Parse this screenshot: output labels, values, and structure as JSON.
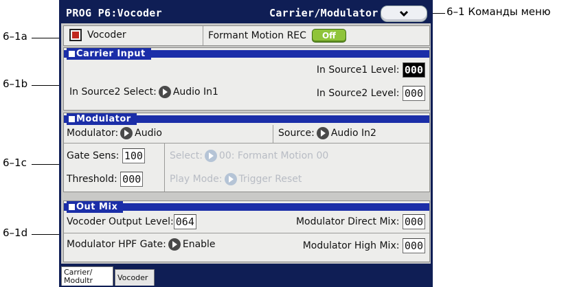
{
  "title": {
    "left": "PROG P6:Vocoder",
    "right": "Carrier/Modulator",
    "menu_icon": "chevron-down-icon"
  },
  "vocoder_row": {
    "checkbox_label": "Vocoder",
    "checkbox_checked": true,
    "formant_label": "Formant Motion REC",
    "formant_button": "Off"
  },
  "carrier_input": {
    "header": "Carrier Input",
    "in_source1_level_label": "In Source1 Level:",
    "in_source1_level_value": "000",
    "in_source2_select_label": "In Source2 Select:",
    "in_source2_select_value": "Audio In1",
    "in_source2_level_label": "In Source2 Level:",
    "in_source2_level_value": "000"
  },
  "modulator": {
    "header": "Modulator",
    "modulator_label": "Modulator:",
    "modulator_value": "Audio",
    "source_label": "Source:",
    "source_value": "Audio In2",
    "gate_sens_label": "Gate Sens:",
    "gate_sens_value": "100",
    "threshold_label": "Threshold:",
    "threshold_value": "000",
    "select_label": "Select:",
    "select_value": "00: Formant Motion 00",
    "play_mode_label": "Play Mode:",
    "play_mode_value": "Trigger Reset"
  },
  "out_mix": {
    "header": "Out Mix",
    "vocoder_output_label": "Vocoder Output Level:",
    "vocoder_output_value": "064",
    "mod_direct_label": "Modulator Direct Mix:",
    "mod_direct_value": "000",
    "hpf_gate_label": "Modulator HPF Gate:",
    "hpf_gate_value": "Enable",
    "high_mix_label": "Modulator High Mix:",
    "high_mix_value": "000"
  },
  "tabs": [
    {
      "label_line1": "Carrier/",
      "label_line2": "Modultr",
      "active": true
    },
    {
      "label_line1": "Vocoder",
      "label_line2": "",
      "active": false
    }
  ],
  "callouts": {
    "menu": "6–1 Команды меню",
    "a": "6–1a",
    "b": "6–1b",
    "c": "6–1c",
    "d": "6–1d"
  },
  "colors": {
    "screen_bg": "#0f1e55",
    "section_header": "#1b2ea8",
    "off_button": "#8fc43a",
    "checkbox_fill": "#c0281f"
  }
}
